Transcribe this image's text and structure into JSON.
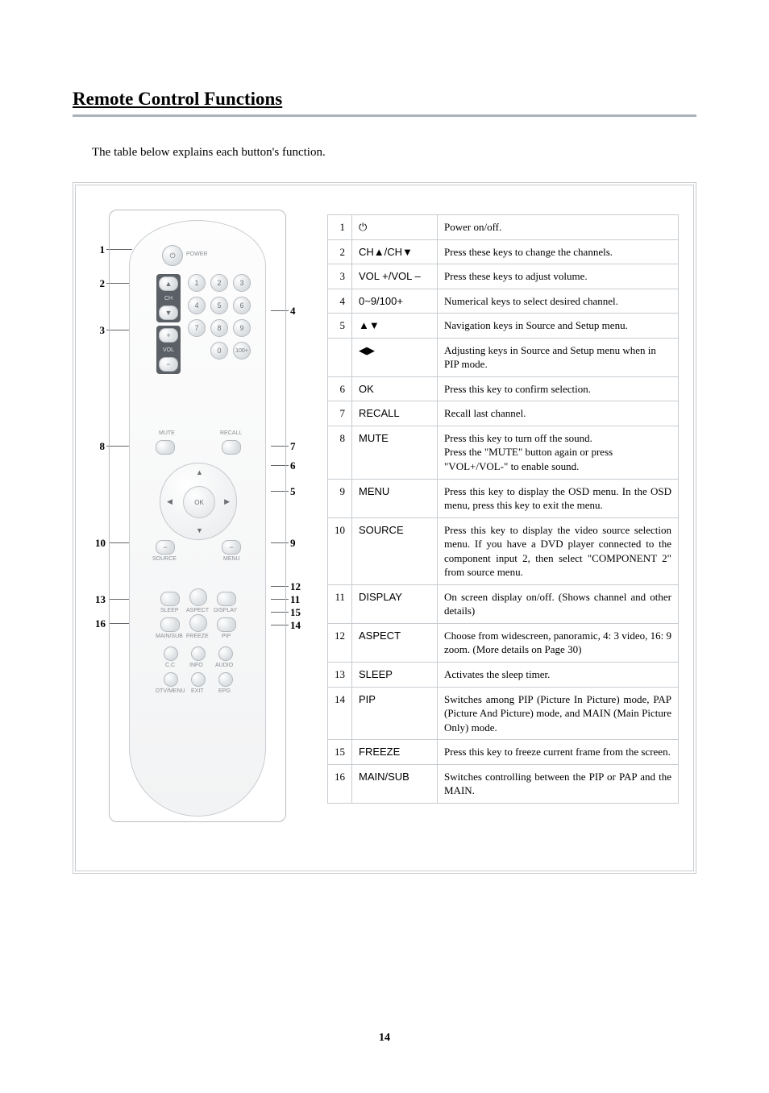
{
  "section_title": "Remote Control Functions",
  "intro_text": "The table below explains each button's function.",
  "page_number": "14",
  "remote": {
    "power_label": "POWER",
    "ch_label": "CH",
    "vol_label": "VOL",
    "mute_label": "MUTE",
    "recall_label": "RECALL",
    "ok_label": "OK",
    "source_label": "SOURCE",
    "menu_label": "MENU",
    "sleep_label": "SLEEP",
    "aspect_label": "ASPECT",
    "display_label": "DISPLAY",
    "mainsub_label": "MAIN/SUB",
    "freeze_label": "FREEZE",
    "pip_label": "PIP",
    "cc_label": "C.C",
    "info_label": "INFO",
    "audio_label": "AUDIO",
    "dtvmenu_label": "DTV/MENU",
    "exit_label": "EXIT",
    "epg_label": "EPG",
    "num_100plus": "100+"
  },
  "callouts_left": [
    "1",
    "2",
    "3",
    "8",
    "10",
    "13",
    "16"
  ],
  "callouts_right": [
    "4",
    "7",
    "6",
    "5",
    "9",
    "12",
    "11",
    "15",
    "14"
  ],
  "rows": [
    {
      "idx": "1",
      "label_is_icon": true,
      "label": "⏻",
      "desc": "Power on/off."
    },
    {
      "idx": "2",
      "label": "CH▲/CH▼",
      "desc": "Press these keys to change the channels."
    },
    {
      "idx": "3",
      "label": "VOL +/VOL –",
      "desc": "Press these keys to adjust volume."
    },
    {
      "idx": "4",
      "label": "0~9/100+",
      "desc": "Numerical keys to select desired channel."
    },
    {
      "idx": "5",
      "label": "▲▼",
      "desc": "Navigation keys in Source and Setup menu."
    },
    {
      "idx": "",
      "label": "◀▶",
      "desc": "Adjusting keys in Source and Setup menu when in PIP mode."
    },
    {
      "idx": "6",
      "label": "OK",
      "desc": "Press this key to confirm selection."
    },
    {
      "idx": "7",
      "label": "RECALL",
      "desc": "Recall last channel."
    },
    {
      "idx": "8",
      "label": "MUTE",
      "desc": "Press this key to turn off the sound.\nPress the \"MUTE\" button again or press \"VOL+/VOL-\" to enable sound."
    },
    {
      "idx": "9",
      "label": "MENU",
      "desc": "Press this key to display the OSD menu.  In the OSD menu, press this key to exit the menu.",
      "justify": true
    },
    {
      "idx": "10",
      "label": "SOURCE",
      "desc": "Press this key to display the video source selection menu. If you have a DVD player connected to the component input 2, then select \"COMPONENT 2\" from source menu.",
      "justify": true
    },
    {
      "idx": "11",
      "label": "DISPLAY",
      "desc": "On screen display on/off.  (Shows channel and other details)",
      "justify": true
    },
    {
      "idx": "12",
      "label": "ASPECT",
      "desc": "Choose from widescreen, panoramic, 4: 3 video, 16: 9 zoom.  (More details on Page 30)"
    },
    {
      "idx": "13",
      "label": "SLEEP",
      "desc": "Activates the sleep timer."
    },
    {
      "idx": "14",
      "label": "PIP",
      "desc": "Switches among PIP (Picture In Picture) mode, PAP (Picture And Picture) mode, and MAIN (Main Picture Only) mode.",
      "justify": true
    },
    {
      "idx": "15",
      "label": "FREEZE",
      "desc": "Press this key to freeze current frame from the screen.",
      "justify": true
    },
    {
      "idx": "16",
      "label": "MAIN/SUB",
      "desc": "Switches controlling between the PIP or PAP and the MAIN.",
      "justify": true
    }
  ]
}
